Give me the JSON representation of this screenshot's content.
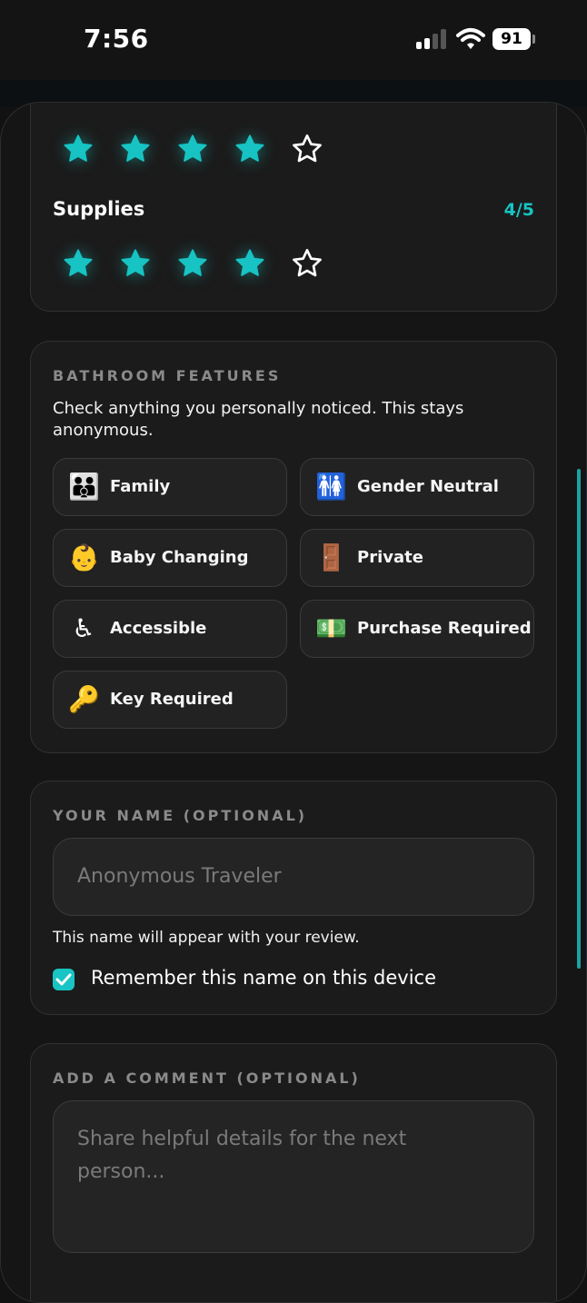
{
  "status_bar": {
    "time": "7:56",
    "battery": "91"
  },
  "ratings": [
    {
      "label": "",
      "score": "",
      "filled": 4,
      "total": 5
    },
    {
      "label": "Supplies",
      "score": "4/5",
      "filled": 4,
      "total": 5
    }
  ],
  "features": {
    "title": "BATHROOM FEATURES",
    "hint": "Check anything you personally noticed. This stays anonymous.",
    "items": [
      {
        "emoji": "👪",
        "label": "Family"
      },
      {
        "emoji": "🚻",
        "label": "Gender Neutral"
      },
      {
        "emoji": "👶",
        "label": "Baby Changing"
      },
      {
        "emoji": "🚪",
        "label": "Private"
      },
      {
        "emoji": "♿",
        "label": "Accessible"
      },
      {
        "emoji": "💵",
        "label": "Purchase Required"
      },
      {
        "emoji": "🔑",
        "label": "Key Required"
      }
    ]
  },
  "name_section": {
    "title": "YOUR NAME (OPTIONAL)",
    "placeholder": "Anonymous Traveler",
    "note": "This name will appear with your review.",
    "remember_label": "Remember this name on this device",
    "remember_checked": true
  },
  "comment_section": {
    "title": "ADD A COMMENT (OPTIONAL)",
    "placeholder": "Share helpful details for the next person..."
  },
  "colors": {
    "accent": "#17c3c3",
    "background": "#121212",
    "card": "#1b1b1b"
  }
}
